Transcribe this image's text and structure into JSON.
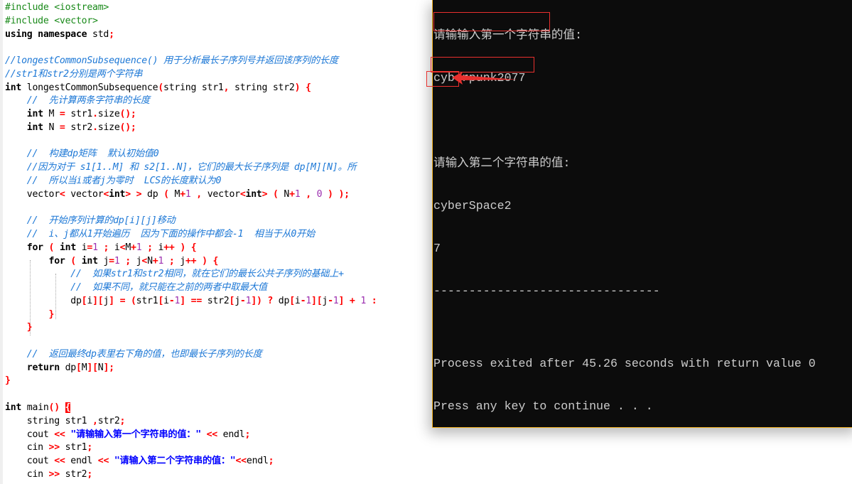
{
  "editor": {
    "language": "cpp",
    "lines": [
      [
        [
          "pp",
          "#include <iostream>"
        ]
      ],
      [
        [
          "pp",
          "#include <vector>"
        ]
      ],
      [
        [
          "kw",
          "using namespace "
        ],
        [
          "id",
          "std"
        ],
        [
          "sym",
          ";"
        ]
      ],
      [],
      [
        [
          "cm",
          "//longestCommonSubsequence() 用于分析最长子序列号并返回该序列的长度"
        ]
      ],
      [
        [
          "cm",
          "//str1和str2分别是两个字符串"
        ]
      ],
      [
        [
          "kw",
          "int "
        ],
        [
          "id",
          "longestCommonSubsequence"
        ],
        [
          "sym",
          "("
        ],
        [
          "id",
          "string str1"
        ],
        [
          "sym",
          ","
        ],
        [
          "id",
          " string str2"
        ],
        [
          "sym",
          ")"
        ],
        [
          "id",
          " "
        ],
        [
          "sym",
          "{"
        ]
      ],
      [
        [
          "id",
          "    "
        ],
        [
          "cm",
          "//  先计算两条字符串的长度"
        ]
      ],
      [
        [
          "id",
          "    "
        ],
        [
          "kw",
          "int "
        ],
        [
          "id",
          "M "
        ],
        [
          "sym",
          "="
        ],
        [
          "id",
          " str1"
        ],
        [
          "sym",
          "."
        ],
        [
          "id",
          "size"
        ],
        [
          "sym",
          "();"
        ]
      ],
      [
        [
          "id",
          "    "
        ],
        [
          "kw",
          "int "
        ],
        [
          "id",
          "N "
        ],
        [
          "sym",
          "="
        ],
        [
          "id",
          " str2"
        ],
        [
          "sym",
          "."
        ],
        [
          "id",
          "size"
        ],
        [
          "sym",
          "();"
        ]
      ],
      [],
      [
        [
          "id",
          "    "
        ],
        [
          "cm",
          "//  构建dp矩阵  默认初始值0"
        ]
      ],
      [
        [
          "id",
          "    "
        ],
        [
          "cm",
          "//因为对于 s1[1..M] 和 s2[1..N]，它们的最大长子序列是 dp[M][N]。所"
        ]
      ],
      [
        [
          "id",
          "    "
        ],
        [
          "cm",
          "//  所以当i或者j为零时  LCS的长度默认为0"
        ]
      ],
      [
        [
          "id",
          "    vector"
        ],
        [
          "sym",
          "<"
        ],
        [
          "id",
          " vector"
        ],
        [
          "sym",
          "<"
        ],
        [
          "kw",
          "int"
        ],
        [
          "sym",
          ">"
        ],
        [
          "id",
          " "
        ],
        [
          "sym",
          ">"
        ],
        [
          "id",
          " dp "
        ],
        [
          "sym",
          "("
        ],
        [
          "id",
          " M"
        ],
        [
          "sym",
          "+"
        ],
        [
          "num",
          "1"
        ],
        [
          "id",
          " "
        ],
        [
          "sym",
          ","
        ],
        [
          "id",
          " vector"
        ],
        [
          "sym",
          "<"
        ],
        [
          "kw",
          "int"
        ],
        [
          "sym",
          ">"
        ],
        [
          "id",
          " "
        ],
        [
          "sym",
          "("
        ],
        [
          "id",
          " N"
        ],
        [
          "sym",
          "+"
        ],
        [
          "num",
          "1"
        ],
        [
          "id",
          " "
        ],
        [
          "sym",
          ","
        ],
        [
          "id",
          " "
        ],
        [
          "num",
          "0"
        ],
        [
          "id",
          " "
        ],
        [
          "sym",
          ")"
        ],
        [
          "id",
          " "
        ],
        [
          "sym",
          ");"
        ]
      ],
      [],
      [
        [
          "id",
          "    "
        ],
        [
          "cm",
          "//  开始序列计算的dp[i][j]移动"
        ]
      ],
      [
        [
          "id",
          "    "
        ],
        [
          "cm",
          "//  i、j都从1开始遍历  因为下面的操作中都会-1  相当于从0开始"
        ]
      ],
      [
        [
          "id",
          "    "
        ],
        [
          "kw",
          "for "
        ],
        [
          "sym",
          "("
        ],
        [
          "id",
          " "
        ],
        [
          "kw",
          "int "
        ],
        [
          "id",
          "i"
        ],
        [
          "sym",
          "="
        ],
        [
          "num",
          "1"
        ],
        [
          "id",
          " "
        ],
        [
          "sym",
          ";"
        ],
        [
          "id",
          " i"
        ],
        [
          "sym",
          "<"
        ],
        [
          "id",
          "M"
        ],
        [
          "sym",
          "+"
        ],
        [
          "num",
          "1"
        ],
        [
          "id",
          " "
        ],
        [
          "sym",
          ";"
        ],
        [
          "id",
          " i"
        ],
        [
          "sym",
          "++"
        ],
        [
          "id",
          " "
        ],
        [
          "sym",
          ")"
        ],
        [
          "id",
          " "
        ],
        [
          "sym",
          "{"
        ]
      ],
      [
        [
          "id",
          "        "
        ],
        [
          "kw",
          "for "
        ],
        [
          "sym",
          "("
        ],
        [
          "id",
          " "
        ],
        [
          "kw",
          "int "
        ],
        [
          "id",
          "j"
        ],
        [
          "sym",
          "="
        ],
        [
          "num",
          "1"
        ],
        [
          "id",
          " "
        ],
        [
          "sym",
          ";"
        ],
        [
          "id",
          " j"
        ],
        [
          "sym",
          "<"
        ],
        [
          "id",
          "N"
        ],
        [
          "sym",
          "+"
        ],
        [
          "num",
          "1"
        ],
        [
          "id",
          " "
        ],
        [
          "sym",
          ";"
        ],
        [
          "id",
          " j"
        ],
        [
          "sym",
          "++"
        ],
        [
          "id",
          " "
        ],
        [
          "sym",
          ")"
        ],
        [
          "id",
          " "
        ],
        [
          "sym",
          "{"
        ]
      ],
      [
        [
          "id",
          "            "
        ],
        [
          "cm",
          "//  如果str1和str2相同，就在它们的最长公共子序列的基础上+"
        ]
      ],
      [
        [
          "id",
          "            "
        ],
        [
          "cm",
          "//  如果不同，就只能在之前的两者中取最大值"
        ]
      ],
      [
        [
          "id",
          "            dp"
        ],
        [
          "sym",
          "["
        ],
        [
          "id",
          "i"
        ],
        [
          "sym",
          "]["
        ],
        [
          "id",
          "j"
        ],
        [
          "sym",
          "]"
        ],
        [
          "id",
          " "
        ],
        [
          "sym",
          "="
        ],
        [
          "id",
          " "
        ],
        [
          "sym",
          "("
        ],
        [
          "id",
          "str1"
        ],
        [
          "sym",
          "["
        ],
        [
          "id",
          "i"
        ],
        [
          "sym",
          "-"
        ],
        [
          "num",
          "1"
        ],
        [
          "sym",
          "]"
        ],
        [
          "id",
          " "
        ],
        [
          "sym",
          "=="
        ],
        [
          "id",
          " str2"
        ],
        [
          "sym",
          "["
        ],
        [
          "id",
          "j"
        ],
        [
          "sym",
          "-"
        ],
        [
          "num",
          "1"
        ],
        [
          "sym",
          "])"
        ],
        [
          "id",
          " "
        ],
        [
          "sym",
          "?"
        ],
        [
          "id",
          " dp"
        ],
        [
          "sym",
          "["
        ],
        [
          "id",
          "i"
        ],
        [
          "sym",
          "-"
        ],
        [
          "num",
          "1"
        ],
        [
          "sym",
          "]["
        ],
        [
          "id",
          "j"
        ],
        [
          "sym",
          "-"
        ],
        [
          "num",
          "1"
        ],
        [
          "sym",
          "]"
        ],
        [
          "id",
          " "
        ],
        [
          "sym",
          "+"
        ],
        [
          "id",
          " "
        ],
        [
          "num",
          "1"
        ],
        [
          "id",
          " "
        ],
        [
          "sym",
          ":"
        ]
      ],
      [
        [
          "id",
          "        "
        ],
        [
          "sym",
          "}"
        ]
      ],
      [
        [
          "id",
          "    "
        ],
        [
          "sym",
          "}"
        ]
      ],
      [],
      [
        [
          "id",
          "    "
        ],
        [
          "cm",
          "//  返回最终dp表里右下角的值，也即最长子序列的长度"
        ]
      ],
      [
        [
          "id",
          "    "
        ],
        [
          "kw",
          "return "
        ],
        [
          "id",
          "dp"
        ],
        [
          "sym",
          "["
        ],
        [
          "id",
          "M"
        ],
        [
          "sym",
          "]["
        ],
        [
          "id",
          "N"
        ],
        [
          "sym",
          "];"
        ]
      ],
      [
        [
          "sym",
          "}"
        ]
      ],
      [],
      [
        [
          "kw",
          "int "
        ],
        [
          "id",
          "main"
        ],
        [
          "sym",
          "()"
        ],
        [
          "id",
          " "
        ],
        [
          "hl",
          "{"
        ]
      ],
      [
        [
          "id",
          "    string str1 "
        ],
        [
          "sym",
          ","
        ],
        [
          "id",
          "str2"
        ],
        [
          "sym",
          ";"
        ]
      ],
      [
        [
          "id",
          "    cout "
        ],
        [
          "sym",
          "<<"
        ],
        [
          "id",
          " "
        ],
        [
          "str",
          "\"请输输入第一个字符串的值：\""
        ],
        [
          "id",
          " "
        ],
        [
          "sym",
          "<<"
        ],
        [
          "id",
          " endl"
        ],
        [
          "sym",
          ";"
        ]
      ],
      [
        [
          "id",
          "    cin "
        ],
        [
          "sym",
          ">>"
        ],
        [
          "id",
          " str1"
        ],
        [
          "sym",
          ";"
        ]
      ],
      [
        [
          "id",
          "    cout "
        ],
        [
          "sym",
          "<<"
        ],
        [
          "id",
          " endl "
        ],
        [
          "sym",
          "<<"
        ],
        [
          "id",
          " "
        ],
        [
          "str",
          "\"请输入第二个字符串的值：\""
        ],
        [
          "sym",
          "<<"
        ],
        [
          "id",
          "endl"
        ],
        [
          "sym",
          ";"
        ]
      ],
      [
        [
          "id",
          "    cin "
        ],
        [
          "sym",
          ">>"
        ],
        [
          "id",
          " str2"
        ],
        [
          "sym",
          ";"
        ]
      ]
    ]
  },
  "console": {
    "lines": [
      "请输输入第一个字符串的值:",
      "cyberpunk2077",
      "",
      "请输入第二个字符串的值:",
      "cyberSpace2",
      "7",
      "--------------------------------",
      "",
      "Process exited after 45.26 seconds with return value 0",
      "Press any key to continue . . ."
    ],
    "input1": "cyberpunk2077",
    "input2": "cyberSpace2",
    "result": "7",
    "elapsed_seconds": "45.26",
    "return_value": "0"
  },
  "annotations": {
    "color": "#e8302e",
    "boxes": [
      "input1-highlight",
      "input2-highlight",
      "result-highlight"
    ],
    "arrow_target": "result"
  },
  "colors": {
    "console_bg": "#0c0c0c",
    "console_text": "#cccccc",
    "console_border": "#f2b01e",
    "comment": "#1d78d6",
    "string": "#0000ff",
    "symbol": "#ff0000",
    "number": "#9c2fb0",
    "preprocessor": "#1a8a1a"
  }
}
